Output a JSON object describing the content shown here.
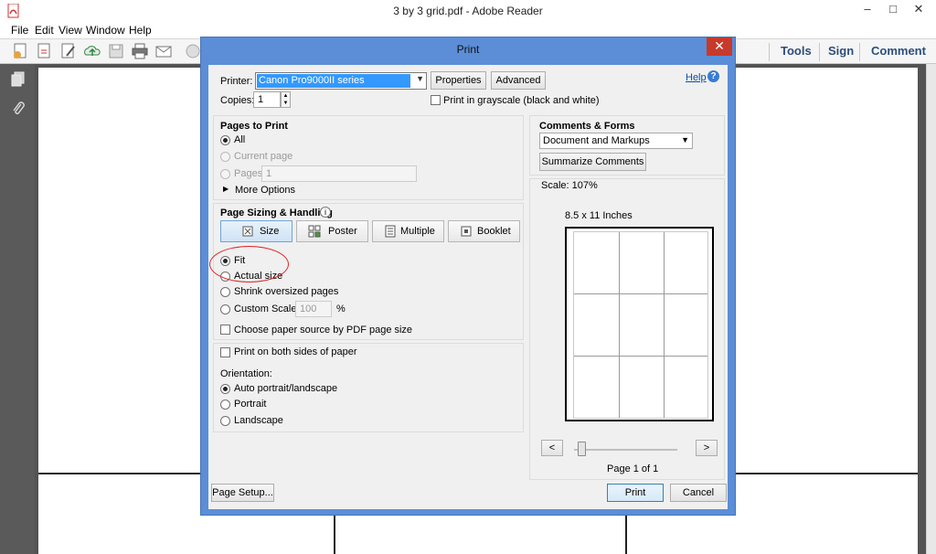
{
  "window": {
    "title": "3 by 3 grid.pdf - Adobe Reader"
  },
  "menu": [
    "File",
    "Edit",
    "View",
    "Window",
    "Help"
  ],
  "right_tools": [
    "Tools",
    "Sign",
    "Comment"
  ],
  "dialog": {
    "title": "Print",
    "printer": {
      "label": "Printer:",
      "value": "Canon Pro9000II series",
      "properties": "Properties",
      "advanced": "Advanced",
      "help": "Help"
    },
    "copies": {
      "label": "Copies:",
      "value": "1"
    },
    "grayscale": "Print in grayscale (black and white)",
    "pages_to_print": {
      "title": "Pages to Print",
      "all": "All",
      "current": "Current page",
      "pages": "Pages",
      "pages_value": "1",
      "more": "More Options"
    },
    "sizing": {
      "title": "Page Sizing & Handling",
      "tabs": [
        "Size",
        "Poster",
        "Multiple",
        "Booklet"
      ],
      "fit": "Fit",
      "actual": "Actual size",
      "shrink": "Shrink oversized pages",
      "custom": "Custom Scale:",
      "custom_value": "100",
      "percent": "%",
      "paper_source": "Choose paper source by PDF page size"
    },
    "both_sides": "Print on both sides of paper",
    "orientation": {
      "title": "Orientation:",
      "auto": "Auto portrait/landscape",
      "portrait": "Portrait",
      "landscape": "Landscape"
    },
    "comments": {
      "title": "Comments & Forms",
      "value": "Document and Markups",
      "summarize": "Summarize Comments"
    },
    "preview": {
      "scale": "Scale: 107%",
      "size": "8.5 x 11 Inches",
      "prev": "<",
      "next": ">",
      "page": "Page 1 of 1"
    },
    "page_setup": "Page Setup...",
    "print": "Print",
    "cancel": "Cancel"
  },
  "colors": {
    "titlebar_blue": "#5b8ed7",
    "close_red": "#c7392b",
    "selection": "#3399ff",
    "annotation": "#e0242a"
  }
}
